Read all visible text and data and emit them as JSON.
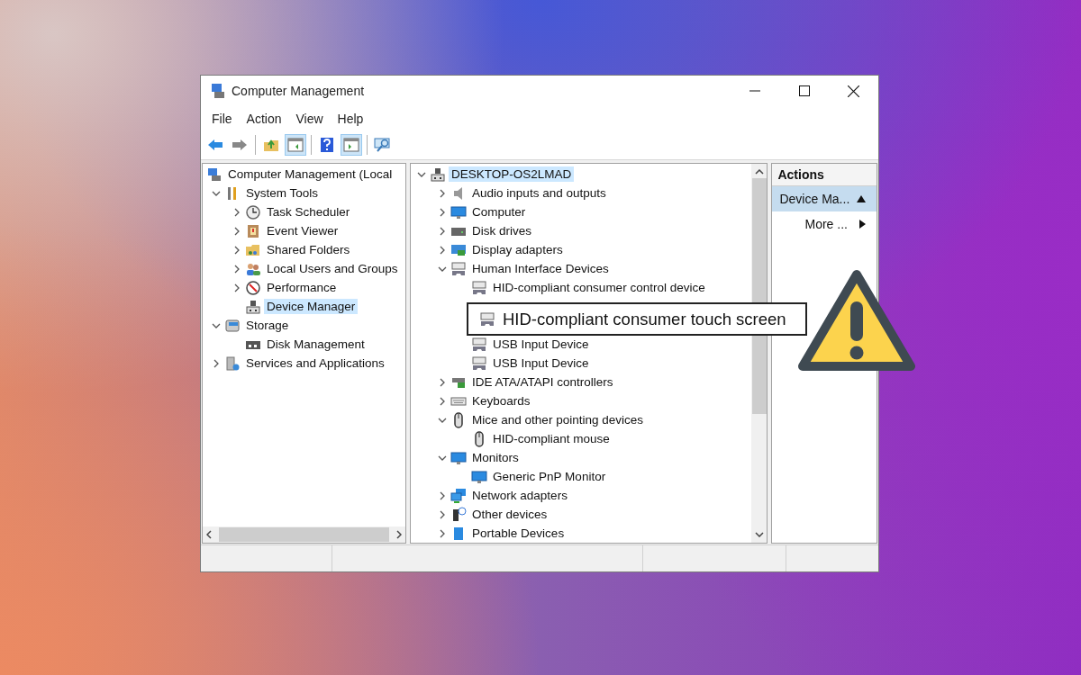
{
  "window": {
    "title": "Computer Management"
  },
  "menu": [
    {
      "label": "File"
    },
    {
      "label": "Action"
    },
    {
      "label": "View"
    },
    {
      "label": "Help"
    }
  ],
  "toolbar": [
    {
      "kind": "back",
      "on": false
    },
    {
      "kind": "forward",
      "on": false
    },
    {
      "kind": "sep"
    },
    {
      "kind": "up",
      "on": false
    },
    {
      "kind": "tree",
      "on": true
    },
    {
      "kind": "sep"
    },
    {
      "kind": "help",
      "on": false
    },
    {
      "kind": "pane",
      "on": true
    },
    {
      "kind": "sep"
    },
    {
      "kind": "connect",
      "on": false
    }
  ],
  "console_tree": [
    {
      "kind": "row",
      "label": "Computer Management (Local",
      "selected": false,
      "children": [
        {
          "kind": "row",
          "label": "System Tools",
          "expanded": true,
          "selected": false,
          "children": [
            {
              "kind": "row",
              "label": "Task Scheduler",
              "expanded": false,
              "selected": false
            },
            {
              "kind": "row",
              "label": "Event Viewer",
              "expanded": false,
              "selected": false
            },
            {
              "kind": "row",
              "label": "Shared Folders",
              "expanded": false,
              "selected": false
            },
            {
              "kind": "row",
              "label": "Local Users and Groups",
              "expanded": false,
              "selected": false
            },
            {
              "kind": "row",
              "label": "Performance",
              "expanded": false,
              "selected": false
            },
            {
              "kind": "row",
              "label": "Device Manager",
              "selected": true
            }
          ]
        },
        {
          "kind": "row",
          "label": "Storage",
          "expanded": true,
          "selected": false,
          "children": [
            {
              "kind": "row",
              "label": "Disk Management",
              "selected": false
            }
          ]
        },
        {
          "kind": "row",
          "label": "Services and Applications",
          "expanded": false,
          "selected": false
        }
      ]
    }
  ],
  "device_tree": [
    {
      "kind": "row",
      "label": "DESKTOP-OS2LMAD",
      "expanded": true,
      "selected": true,
      "children": [
        {
          "kind": "row",
          "label": "Audio inputs and outputs",
          "expanded": false,
          "selected": false
        },
        {
          "kind": "row",
          "label": "Computer",
          "expanded": false,
          "selected": false
        },
        {
          "kind": "row",
          "label": "Disk drives",
          "expanded": false,
          "selected": false
        },
        {
          "kind": "row",
          "label": "Display adapters",
          "expanded": false,
          "selected": false
        },
        {
          "kind": "row",
          "label": "Human Interface Devices",
          "expanded": true,
          "selected": false,
          "children": [
            {
              "kind": "row",
              "label": "HID-compliant consumer control device",
              "selected": false
            },
            {
              "kind": "callout",
              "label": "HID-compliant consumer touch screen"
            },
            {
              "kind": "row",
              "label": "USB Input Device",
              "selected": false
            },
            {
              "kind": "row",
              "label": "USB Input Device",
              "selected": false
            }
          ]
        },
        {
          "kind": "row",
          "label": "IDE ATA/ATAPI controllers",
          "expanded": false,
          "selected": false
        },
        {
          "kind": "row",
          "label": "Keyboards",
          "expanded": false,
          "selected": false
        },
        {
          "kind": "row",
          "label": "Mice and other pointing devices",
          "expanded": true,
          "selected": false,
          "children": [
            {
              "kind": "row",
              "label": "HID-compliant mouse",
              "selected": false
            }
          ]
        },
        {
          "kind": "row",
          "label": "Monitors",
          "expanded": true,
          "selected": false,
          "children": [
            {
              "kind": "row",
              "label": "Generic PnP Monitor",
              "selected": false
            }
          ]
        },
        {
          "kind": "row",
          "label": "Network adapters",
          "expanded": false,
          "selected": false
        },
        {
          "kind": "row",
          "label": "Other devices",
          "expanded": false,
          "selected": false
        },
        {
          "kind": "row",
          "label": "Portable Devices",
          "expanded": false,
          "selected": false
        }
      ]
    }
  ],
  "actions": {
    "title": "Actions",
    "items": [
      {
        "kind": "section",
        "label": "Device Ma...",
        "selected": true
      },
      {
        "kind": "more",
        "label": "More ...",
        "selected": false
      }
    ]
  }
}
